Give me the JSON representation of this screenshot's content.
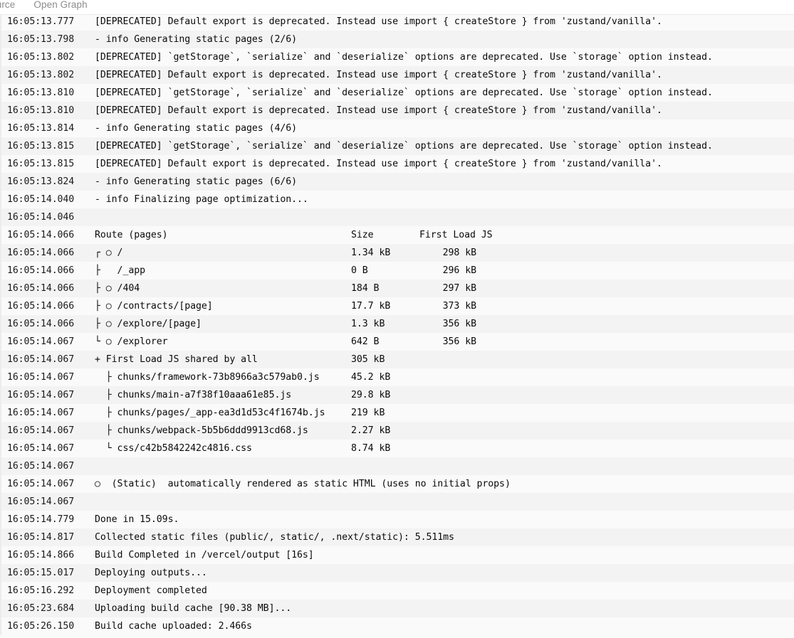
{
  "tabs": [
    {
      "label": "Source",
      "name": "tab-source"
    },
    {
      "label": "Open Graph",
      "name": "tab-open-graph"
    }
  ],
  "log": {
    "lines": [
      {
        "ts": "16:05:13.777",
        "msg": "[DEPRECATED] Default export is deprecated. Instead use import { createStore } from 'zustand/vanilla'."
      },
      {
        "ts": "16:05:13.798",
        "msg": "- info Generating static pages (2/6)"
      },
      {
        "ts": "16:05:13.802",
        "msg": "[DEPRECATED] `getStorage`, `serialize` and `deserialize` options are deprecated. Use `storage` option instead."
      },
      {
        "ts": "16:05:13.802",
        "msg": "[DEPRECATED] Default export is deprecated. Instead use import { createStore } from 'zustand/vanilla'."
      },
      {
        "ts": "16:05:13.810",
        "msg": "[DEPRECATED] `getStorage`, `serialize` and `deserialize` options are deprecated. Use `storage` option instead."
      },
      {
        "ts": "16:05:13.810",
        "msg": "[DEPRECATED] Default export is deprecated. Instead use import { createStore } from 'zustand/vanilla'."
      },
      {
        "ts": "16:05:13.814",
        "msg": "- info Generating static pages (4/6)"
      },
      {
        "ts": "16:05:13.815",
        "msg": "[DEPRECATED] `getStorage`, `serialize` and `deserialize` options are deprecated. Use `storage` option instead."
      },
      {
        "ts": "16:05:13.815",
        "msg": "[DEPRECATED] Default export is deprecated. Instead use import { createStore } from 'zustand/vanilla'."
      },
      {
        "ts": "16:05:13.824",
        "msg": "- info Generating static pages (6/6)"
      },
      {
        "ts": "16:05:14.040",
        "msg": "- info Finalizing page optimization..."
      },
      {
        "ts": "16:05:14.046",
        "msg": ""
      },
      {
        "ts": "16:05:14.066",
        "cols": {
          "route": "Route (pages)",
          "size": "Size",
          "first_load": "First Load JS"
        }
      },
      {
        "ts": "16:05:14.066",
        "cols": {
          "route": "┌ ○ /",
          "size": "1.34 kB",
          "first_load": "298 kB"
        }
      },
      {
        "ts": "16:05:14.066",
        "cols": {
          "route": "├   /_app",
          "size": "0 B",
          "first_load": "296 kB"
        }
      },
      {
        "ts": "16:05:14.066",
        "cols": {
          "route": "├ ○ /404",
          "size": "184 B",
          "first_load": "297 kB"
        }
      },
      {
        "ts": "16:05:14.066",
        "cols": {
          "route": "├ ○ /contracts/[page]",
          "size": "17.7 kB",
          "first_load": "373 kB"
        }
      },
      {
        "ts": "16:05:14.066",
        "cols": {
          "route": "├ ○ /explore/[page]",
          "size": "1.3 kB",
          "first_load": "356 kB"
        }
      },
      {
        "ts": "16:05:14.067",
        "cols": {
          "route": "└ ○ /explorer",
          "size": "642 B",
          "first_load": "356 kB"
        }
      },
      {
        "ts": "16:05:14.067",
        "cols": {
          "route": "+ First Load JS shared by all",
          "size": "305 kB",
          "first_load": ""
        }
      },
      {
        "ts": "16:05:14.067",
        "cols": {
          "route": "  ├ chunks/framework-73b8966a3c579ab0.js",
          "size": "45.2 kB",
          "first_load": ""
        }
      },
      {
        "ts": "16:05:14.067",
        "cols": {
          "route": "  ├ chunks/main-a7f38f10aaa61e85.js",
          "size": "29.8 kB",
          "first_load": ""
        }
      },
      {
        "ts": "16:05:14.067",
        "cols": {
          "route": "  ├ chunks/pages/_app-ea3d1d53c4f1674b.js",
          "size": "219 kB",
          "first_load": ""
        }
      },
      {
        "ts": "16:05:14.067",
        "cols": {
          "route": "  ├ chunks/webpack-5b5b6ddd9913cd68.js",
          "size": "2.27 kB",
          "first_load": ""
        }
      },
      {
        "ts": "16:05:14.067",
        "cols": {
          "route": "  └ css/c42b5842242c4816.css",
          "size": "8.74 kB",
          "first_load": ""
        }
      },
      {
        "ts": "16:05:14.067",
        "msg": ""
      },
      {
        "ts": "16:05:14.067",
        "msg": "○  (Static)  automatically rendered as static HTML (uses no initial props)"
      },
      {
        "ts": "16:05:14.067",
        "msg": ""
      },
      {
        "ts": "16:05:14.779",
        "msg": "Done in 15.09s."
      },
      {
        "ts": "16:05:14.817",
        "msg": "Collected static files (public/, static/, .next/static): 5.511ms"
      },
      {
        "ts": "16:05:14.866",
        "msg": "Build Completed in /vercel/output [16s]"
      },
      {
        "ts": "16:05:15.017",
        "msg": "Deploying outputs..."
      },
      {
        "ts": "16:05:16.292",
        "msg": "Deployment completed"
      },
      {
        "ts": "16:05:23.684",
        "msg": "Uploading build cache [90.38 MB]..."
      },
      {
        "ts": "16:05:26.150",
        "msg": "Build cache uploaded: 2.466s"
      }
    ]
  }
}
